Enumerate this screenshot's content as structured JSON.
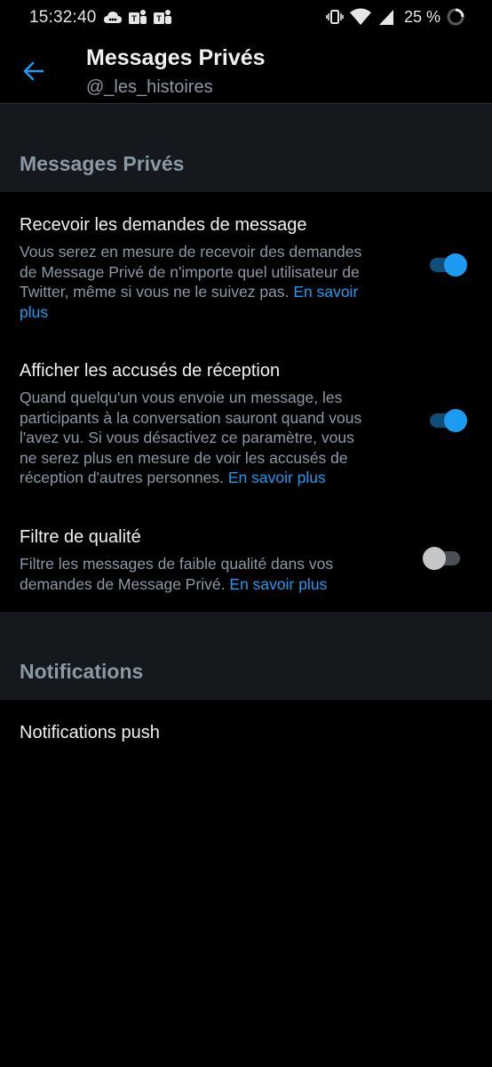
{
  "status_bar": {
    "time": "15:32:40",
    "battery": "25 %"
  },
  "header": {
    "title": "Messages Privés",
    "subtitle": "@_les_histoires"
  },
  "sections": {
    "messages": {
      "title": "Messages Privés",
      "settings": [
        {
          "title": "Recevoir les demandes de message",
          "desc_line1": "Vous serez en mesure de recevoir des demandes",
          "desc_line2": "de Message Privé de n'importe quel utilisateur de",
          "desc_line3": "Twitter, même si vous ne le suivez pas. ",
          "link_a": "En savoir",
          "link_b": "plus",
          "enabled": true
        },
        {
          "title": "Afficher les accusés de réception",
          "desc_line1": "Quand quelqu'un vous envoie un message, les",
          "desc_line2": "participants à la conversation sauront quand vous",
          "desc_line3": "l'avez vu. Si vous désactivez ce paramètre, vous",
          "desc_line4": "ne serez plus en mesure de voir les accusés de",
          "desc_line5": "réception d'autres personnes. ",
          "link": "En savoir plus",
          "enabled": true
        },
        {
          "title": "Filtre de qualité",
          "desc_line1": "Filtre les messages de faible qualité dans vos",
          "desc_line2": "demandes de Message Privé. ",
          "link": "En savoir plus",
          "enabled": false
        }
      ]
    },
    "notifications": {
      "title": "Notifications",
      "items": [
        "Notifications push"
      ]
    }
  },
  "colors": {
    "background": "#000000",
    "section_bg": "#15181c",
    "accent": "#1d9bf0",
    "secondary_text": "#8b98a5"
  }
}
